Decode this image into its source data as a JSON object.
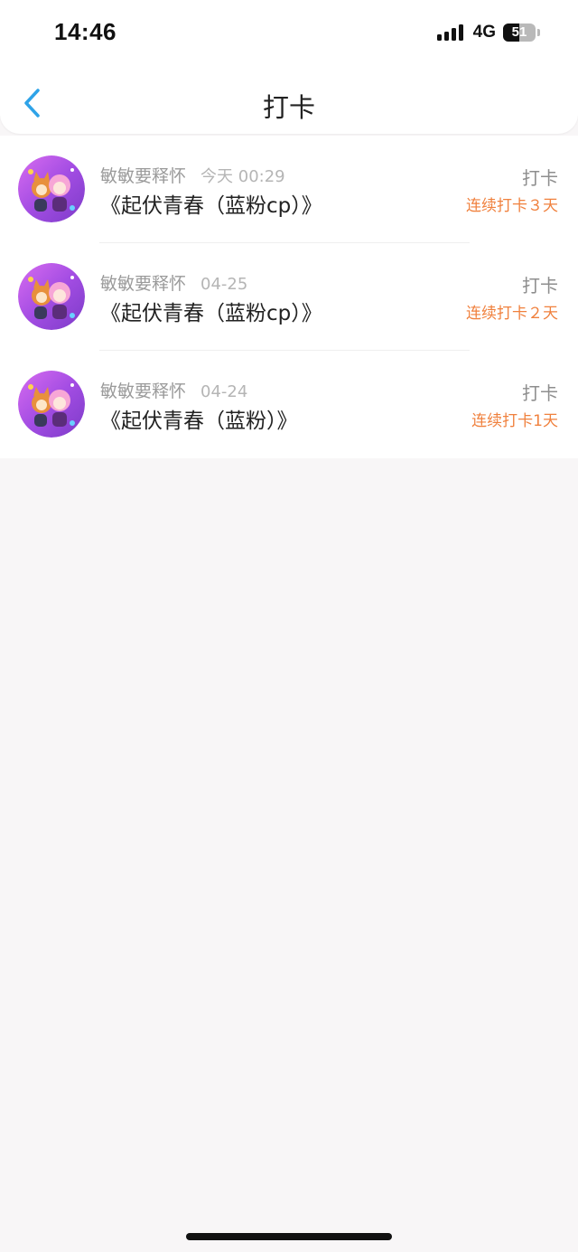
{
  "status_bar": {
    "time": "14:46",
    "network": "4G",
    "battery": "51",
    "battery_level": 0.51
  },
  "header": {
    "title": "打卡",
    "accent_color": "#2ea3e8"
  },
  "checkins": [
    {
      "author": "敏敏要释怀",
      "date": "今天 00:29",
      "title": "《起伏青春（蓝粉cp）》",
      "action": "打卡",
      "streak": "连续打卡３天"
    },
    {
      "author": "敏敏要释怀",
      "date": "04-25",
      "title": "《起伏青春（蓝粉cp）》",
      "action": "打卡",
      "streak": "连续打卡２天"
    },
    {
      "author": "敏敏要释怀",
      "date": "04-24",
      "title": "《起伏青春（蓝粉）》",
      "action": "打卡",
      "streak": "连续打卡1天"
    }
  ],
  "colors": {
    "streak": "#f0813e",
    "background": "#f8f6f7"
  }
}
